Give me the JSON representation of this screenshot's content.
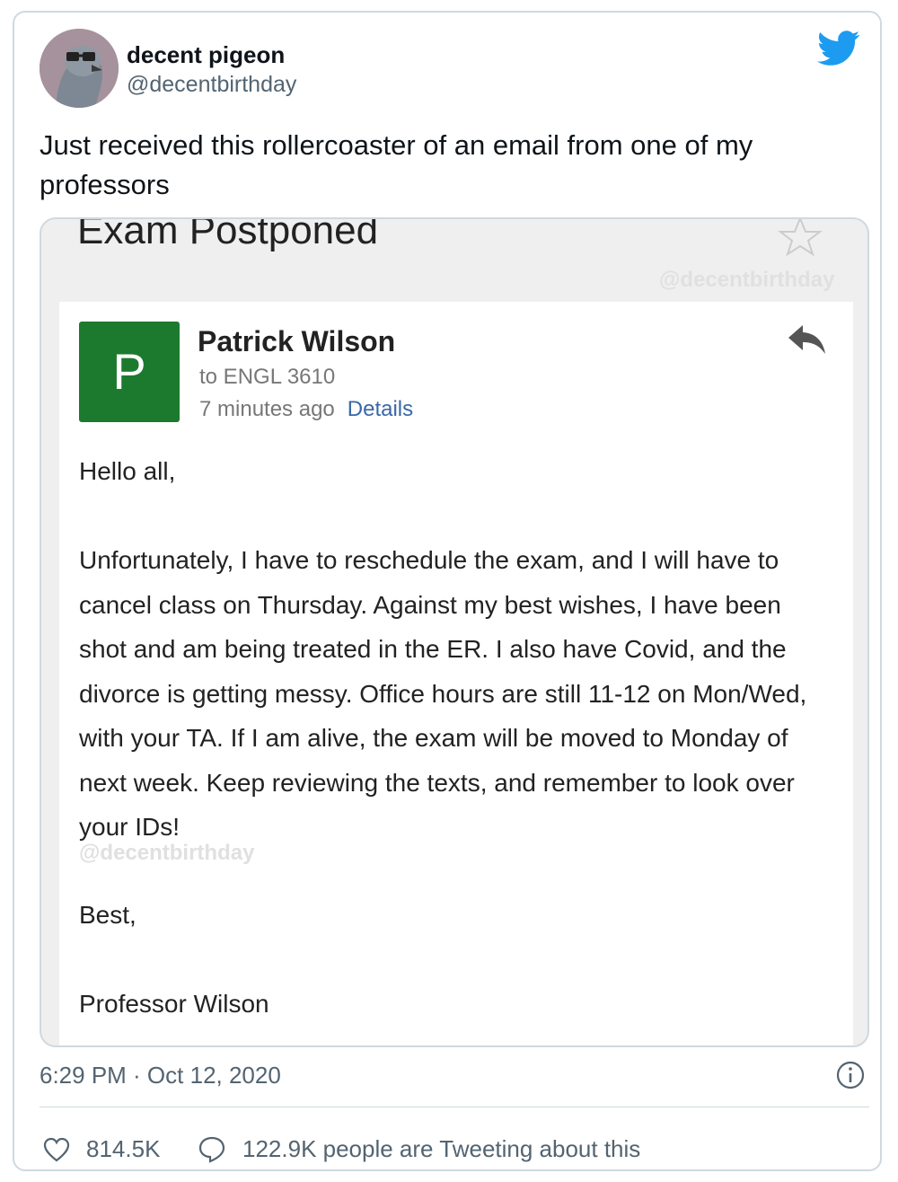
{
  "author": {
    "name": "decent pigeon",
    "handle": "@decentbirthday",
    "avatar_icon": "pigeon-avatar-with-glasses"
  },
  "tweet": {
    "text": "Just received this rollercoaster of an email from one of my professors",
    "timestamp": "6:29 PM · Oct 12, 2020",
    "likes": "814.5K",
    "tweeting": "122.9K people are Tweeting about this"
  },
  "email": {
    "subject": "Exam Postponed",
    "watermark": "@decentbirthday",
    "sender_initial": "P",
    "sender_name": "Patrick Wilson",
    "to_line": "to ENGL 3610",
    "time_ago": "7 minutes ago",
    "details_link": "Details",
    "greeting": "Hello all,",
    "body": "Unfortunately, I have to reschedule the exam, and I will have to cancel class on Thursday. Against my best wishes, I have been shot and am being treated in the ER. I also have Covid, and the divorce is getting messy. Office hours are still 11-12 on Mon/Wed, with your TA. If I am alive, the exam will be moved to Monday of next week. Keep reviewing the texts, and remember to look over your IDs!",
    "closing": "Best,",
    "signature": "Professor Wilson"
  },
  "colors": {
    "twitter_blue": "#1d9bf0",
    "sender_green": "#1c7a2e",
    "link_blue": "#3a67a8"
  },
  "icons": [
    "twitter-bird-icon",
    "star-icon",
    "reply-icon",
    "info-icon",
    "heart-icon",
    "comment-icon"
  ]
}
